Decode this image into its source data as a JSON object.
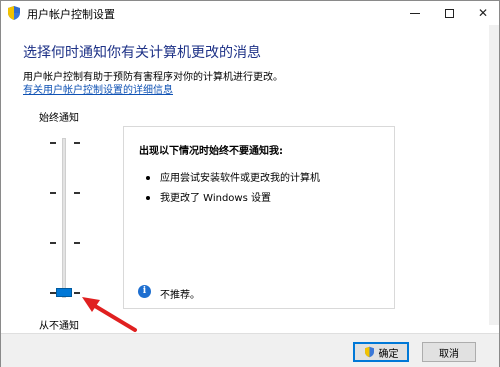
{
  "window": {
    "title": "用户帐户控制设置"
  },
  "main": {
    "heading": "选择何时通知你有关计算机更改的消息",
    "description": "用户帐户控制有助于预防有害程序对你的计算机进行更改。",
    "link": "有关用户帐户控制设置的详细信息"
  },
  "slider": {
    "top_label": "始终通知",
    "bottom_label": "从不通知",
    "level_index": 0,
    "levels_count": 4
  },
  "panel": {
    "title": "出现以下情况时始终不要通知我:",
    "bullets": [
      "应用尝试安装软件或更改我的计算机",
      "我更改了 Windows 设置"
    ],
    "note": "不推荐。"
  },
  "footer": {
    "ok_label": "确定",
    "cancel_label": "取消"
  },
  "colors": {
    "heading": "#1e3287",
    "link": "#0f52b4",
    "thumb": "#0078d7",
    "annotation_arrow": "#e02020"
  },
  "icons": {
    "title": "uac-shield-icon",
    "ok": "uac-shield-icon",
    "info": "info-icon",
    "close": "close-icon",
    "minimize": "minimize-icon",
    "maximize": "maximize-icon"
  }
}
